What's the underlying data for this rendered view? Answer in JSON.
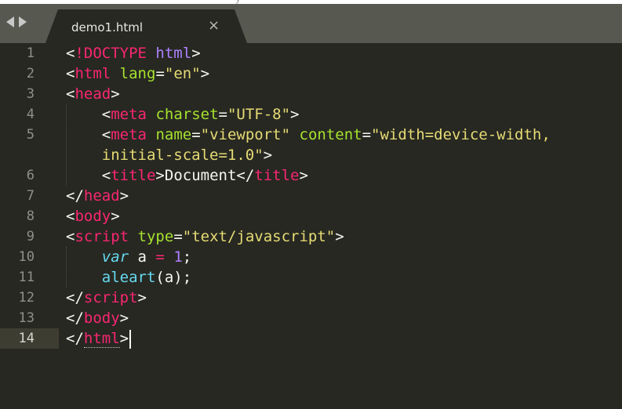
{
  "titlebar": {
    "ghost_text": "y"
  },
  "tab": {
    "label": "demo1.html",
    "close_glyph": "×"
  },
  "editor": {
    "active_line": 14,
    "line_numbers": [
      "1",
      "2",
      "3",
      "4",
      "5",
      "6",
      "7",
      "8",
      "9",
      "10",
      "11",
      "12",
      "13",
      "14"
    ],
    "lines": [
      {
        "number": "1",
        "tokens": [
          [
            "<",
            "pun"
          ],
          [
            "!DOCTYPE",
            "tag"
          ],
          [
            " ",
            "txt"
          ],
          [
            "html",
            "doc"
          ],
          [
            ">",
            "pun"
          ]
        ]
      },
      {
        "number": "2",
        "tokens": [
          [
            "<",
            "pun"
          ],
          [
            "html",
            "tag"
          ],
          [
            " ",
            "txt"
          ],
          [
            "lang",
            "attr"
          ],
          [
            "=",
            "pun"
          ],
          [
            "\"en\"",
            "str"
          ],
          [
            ">",
            "pun"
          ]
        ]
      },
      {
        "number": "3",
        "tokens": [
          [
            "<",
            "pun"
          ],
          [
            "head",
            "tag"
          ],
          [
            ">",
            "pun"
          ]
        ]
      },
      {
        "number": "4",
        "tokens": [
          [
            "    ",
            "txt"
          ],
          [
            "<",
            "pun"
          ],
          [
            "meta",
            "tag"
          ],
          [
            " ",
            "txt"
          ],
          [
            "charset",
            "attr"
          ],
          [
            "=",
            "pun"
          ],
          [
            "\"UTF-8\"",
            "str"
          ],
          [
            ">",
            "pun"
          ]
        ]
      },
      {
        "number": "5",
        "tokens": [
          [
            "    ",
            "txt"
          ],
          [
            "<",
            "pun"
          ],
          [
            "meta",
            "tag"
          ],
          [
            " ",
            "txt"
          ],
          [
            "name",
            "attr"
          ],
          [
            "=",
            "pun"
          ],
          [
            "\"viewport\"",
            "str"
          ],
          [
            " ",
            "txt"
          ],
          [
            "content",
            "attr"
          ],
          [
            "=",
            "pun"
          ],
          [
            "\"width=device-width,",
            "str"
          ]
        ]
      },
      {
        "number": "",
        "tokens": [
          [
            "    ",
            "txt"
          ],
          [
            "initial-scale=1.0\"",
            "str"
          ],
          [
            ">",
            "pun"
          ]
        ]
      },
      {
        "number": "6",
        "tokens": [
          [
            "    ",
            "txt"
          ],
          [
            "<",
            "pun"
          ],
          [
            "title",
            "tag"
          ],
          [
            ">",
            "pun"
          ],
          [
            "Document",
            "txt"
          ],
          [
            "</",
            "pun"
          ],
          [
            "title",
            "tag"
          ],
          [
            ">",
            "pun"
          ]
        ]
      },
      {
        "number": "7",
        "tokens": [
          [
            "</",
            "pun"
          ],
          [
            "head",
            "tag"
          ],
          [
            ">",
            "pun"
          ]
        ]
      },
      {
        "number": "8",
        "tokens": [
          [
            "<",
            "pun"
          ],
          [
            "body",
            "tag"
          ],
          [
            ">",
            "pun"
          ]
        ]
      },
      {
        "number": "9",
        "tokens": [
          [
            "<",
            "pun"
          ],
          [
            "script",
            "tag"
          ],
          [
            " ",
            "txt"
          ],
          [
            "type",
            "attr"
          ],
          [
            "=",
            "pun"
          ],
          [
            "\"text/javascript\"",
            "str"
          ],
          [
            ">",
            "pun"
          ]
        ]
      },
      {
        "number": "10",
        "tokens": [
          [
            "    ",
            "txt"
          ],
          [
            "var",
            "kw"
          ],
          [
            " a ",
            "txt"
          ],
          [
            "=",
            "op"
          ],
          [
            " ",
            "txt"
          ],
          [
            "1",
            "num"
          ],
          [
            ";",
            "pun"
          ]
        ]
      },
      {
        "number": "11",
        "tokens": [
          [
            "    ",
            "txt"
          ],
          [
            "aleart",
            "fn"
          ],
          [
            "(a);",
            "pun"
          ]
        ]
      },
      {
        "number": "12",
        "tokens": [
          [
            "</",
            "pun"
          ],
          [
            "script",
            "tag"
          ],
          [
            ">",
            "pun"
          ]
        ]
      },
      {
        "number": "13",
        "tokens": [
          [
            "</",
            "pun"
          ],
          [
            "body",
            "tag"
          ],
          [
            ">",
            "pun"
          ]
        ]
      },
      {
        "number": "14",
        "tokens": [
          [
            "</",
            "pun"
          ],
          [
            "html",
            "tag"
          ],
          [
            ">",
            "pun"
          ]
        ]
      }
    ]
  },
  "colors": {
    "background": "#272822",
    "tab_bar": "#57584f",
    "tag": "#f92672",
    "attribute": "#a6e22e",
    "string": "#e6db74",
    "keyword": "#66d9ef",
    "number": "#ae81ff"
  }
}
